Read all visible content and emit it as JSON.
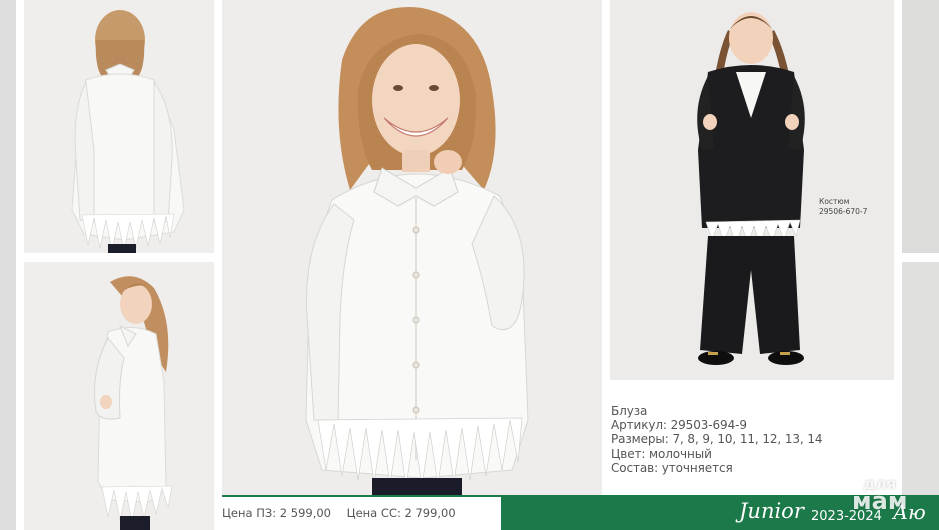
{
  "suit_label": {
    "line1": "Костюм",
    "line2": "29506-670-7"
  },
  "description": {
    "name": "Блуза",
    "article": "Артикул: 29503-694-9",
    "sizes": "Размеры: 7, 8, 9, 10, 11, 12, 13, 14",
    "color": "Цвет: молочный",
    "composition": "Состав: уточняется"
  },
  "prices": {
    "pz": "Цена ПЗ: 2 599,00",
    "ss": "Цена СС: 2 799,00"
  },
  "footer": {
    "brand": "Junior",
    "season": "2023-2024",
    "corner": "Аю",
    "accent_color": "#1c7a4a"
  },
  "watermark": {
    "line1": "для",
    "line2": "мам"
  }
}
